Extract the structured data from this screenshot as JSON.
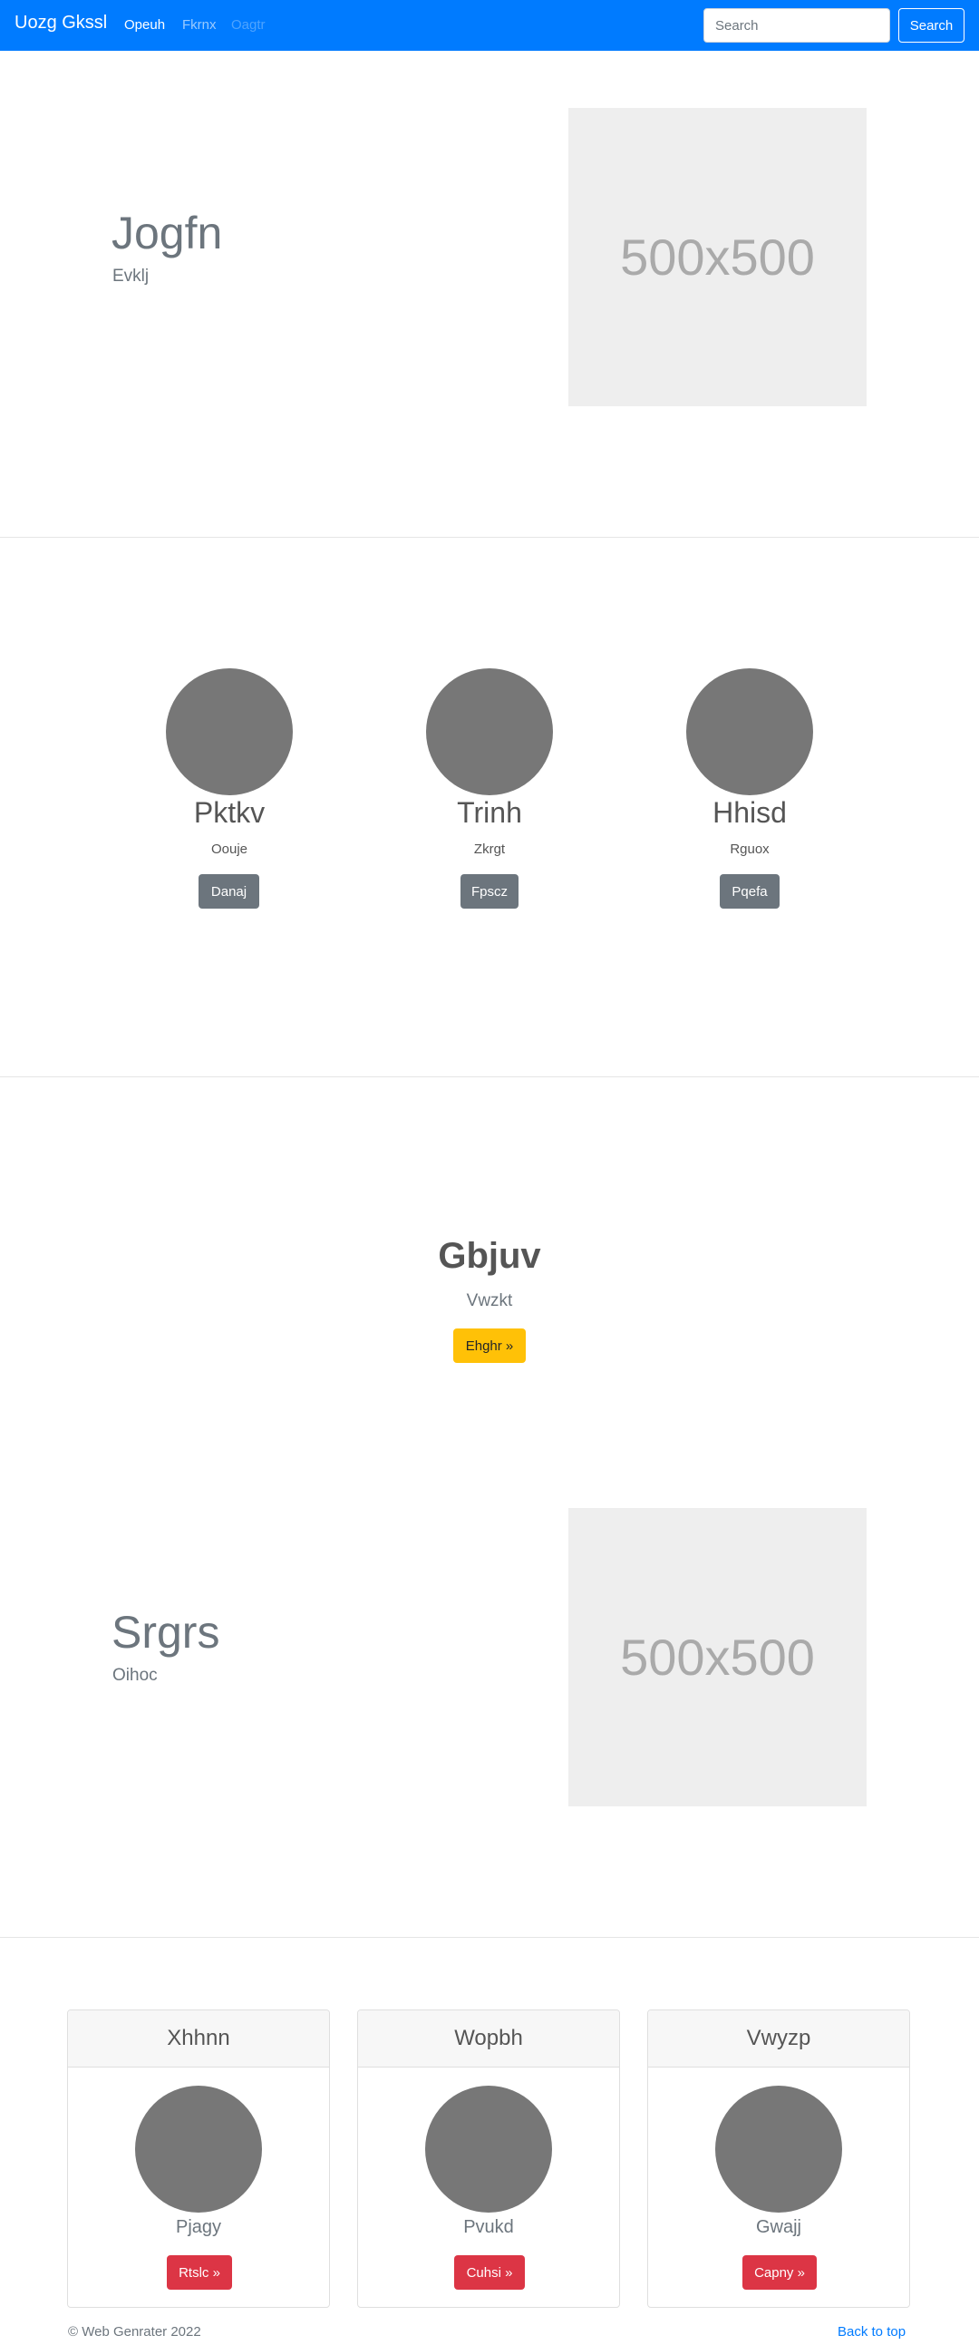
{
  "navbar": {
    "brand": "Uozg Gkssl",
    "links": [
      "Opeuh",
      "Fkrnx",
      "Oagtr"
    ],
    "search_placeholder": "Search",
    "search_button": "Search"
  },
  "feature1": {
    "title": "Jogfn",
    "subtitle": "Evklj",
    "placeholder_text": "500x500"
  },
  "members": [
    {
      "name": "Pktkv",
      "subtitle": "Oouje",
      "button": "Danaj"
    },
    {
      "name": "Trinh",
      "subtitle": "Zkrgt",
      "button": "Fpscz"
    },
    {
      "name": "Hhisd",
      "subtitle": "Rguox",
      "button": "Pqefa"
    }
  ],
  "center": {
    "title": "Gbjuv",
    "subtitle": "Vwzkt",
    "button": "Ehghr »"
  },
  "feature2": {
    "title": "Srgrs",
    "subtitle": "Oihoc",
    "placeholder_text": "500x500"
  },
  "cards": [
    {
      "header": "Xhhnn",
      "subtitle": "Pjagy",
      "button": "Rtslc »"
    },
    {
      "header": "Wopbh",
      "subtitle": "Pvukd",
      "button": "Cuhsi »"
    },
    {
      "header": "Vwyzp",
      "subtitle": "Gwajj",
      "button": "Capny »"
    }
  ],
  "footer": {
    "copyright": "© Web Genrater 2022",
    "back_to_top": "Back to top"
  },
  "colors": {
    "primary": "#007bff",
    "secondary": "#6c757d",
    "warning": "#ffc107",
    "danger": "#dc3545",
    "placeholder_bg": "#eeeeee",
    "circle": "#777777"
  }
}
